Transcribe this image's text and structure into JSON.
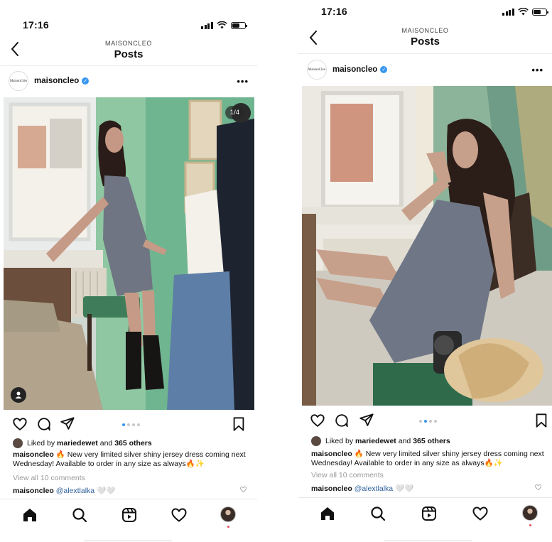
{
  "screens": [
    {
      "status_time": "17:16",
      "header": {
        "subtitle": "MAISONCLEO",
        "title": "Posts"
      },
      "post": {
        "username": "maisoncleo",
        "avatar_text": "MaisonCléo",
        "image_counter": "1/4",
        "carousel": {
          "count": 4,
          "active": 0
        },
        "liked_prefix": "Liked by ",
        "liked_user": "mariedewet",
        "liked_and": " and ",
        "liked_others": "365 others",
        "caption_user": "maisoncleo",
        "caption_text": "🔥 New very limited silver shiny jersey dress coming next Wednesday! Available to order in any size as always🔥✨",
        "view_all": "View all 10 comments",
        "comment_user": "maisoncleo",
        "comment_mention": "@alextlalka",
        "comment_emoji": "🤍🤍"
      }
    },
    {
      "status_time": "17:16",
      "header": {
        "subtitle": "MAISONCLEO",
        "title": "Posts"
      },
      "post": {
        "username": "maisoncleo",
        "avatar_text": "MaisonCléo",
        "carousel": {
          "count": 4,
          "active": 1
        },
        "liked_prefix": "Liked by ",
        "liked_user": "mariedewet",
        "liked_and": " and ",
        "liked_others": "365 others",
        "caption_user": "maisoncleo",
        "caption_text": "🔥 New very limited silver shiny jersey dress coming next Wednesday! Available to order in any size as always🔥✨",
        "view_all": "View all 10 comments",
        "comment_user": "maisoncleo",
        "comment_mention": "@alextlalka",
        "comment_emoji": "🤍🤍"
      }
    }
  ],
  "icons": {
    "back": "chevron-left-icon",
    "more": "more-horizontal-icon",
    "like": "heart-icon",
    "comment": "comment-icon",
    "share": "paper-plane-icon",
    "save": "bookmark-icon",
    "home": "home-icon",
    "search": "search-icon",
    "reels": "reels-icon",
    "activity": "heart-icon",
    "profile": "profile-icon",
    "tagged": "person-tag-icon"
  },
  "colors": {
    "verified": "#3897f0",
    "mention": "#2d5f9a",
    "notification_dot": "#ed4956",
    "wall_green": "#6fb590"
  }
}
